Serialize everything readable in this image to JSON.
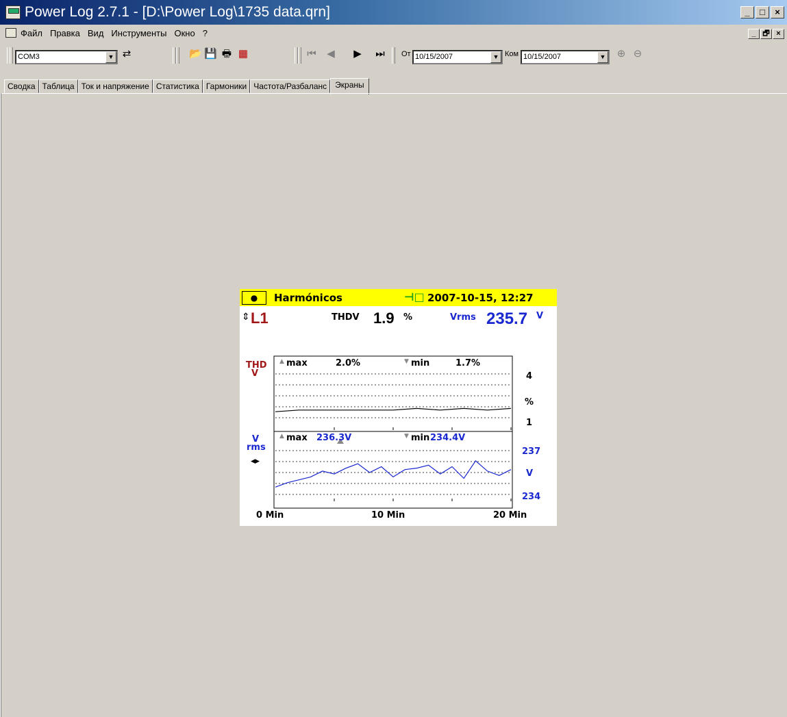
{
  "window": {
    "title": "Power Log 2.7.1 - [D:\\Power Log\\1735 data.qrn]",
    "minimize": "_",
    "maximize": "□",
    "close": "×",
    "mdi_minimize": "_",
    "mdi_restore": "🗗",
    "mdi_close": "×"
  },
  "menu": {
    "items": [
      "Файл",
      "Правка",
      "Вид",
      "Инструменты",
      "Окно",
      "?"
    ]
  },
  "toolbar": {
    "port": "COM3",
    "from_label": "От",
    "from_date": "10/15/2007",
    "to_label": "Ком",
    "to_date": "10/15/2007"
  },
  "tabs": [
    "Сводка",
    "Таблица",
    "Ток и напряжение",
    "Статистика",
    "Гармоники",
    "Частота/Разбаланс",
    "Экраны"
  ],
  "active_tab": "Экраны",
  "screen": {
    "rec_indicator": "●",
    "mode": "Harmónicos",
    "timestamp": "2007-10-15, 12:27",
    "phase": "L1",
    "thdv_label": "THDV",
    "thdv_value": "1.9",
    "thdv_unit": "%",
    "vrms_label": "Vrms",
    "vrms_value": "235.7",
    "vrms_unit": "V",
    "thd_axis_label_top": "THD",
    "thd_axis_label_bottom": "V",
    "thd_max_label": "max",
    "thd_max": "2.0%",
    "thd_min_label": "min",
    "thd_min": "1.7%",
    "thd_scale": [
      "4",
      "%",
      "1"
    ],
    "v_axis_label_top": "V",
    "v_axis_label_bottom": "rms",
    "v_max_label": "max",
    "v_max": "236.3V",
    "v_min_label": "min",
    "v_min": "234.4V",
    "v_scale": [
      "237",
      "V",
      "234"
    ],
    "time_labels": [
      "0 Min",
      "10 Min",
      "20 Min"
    ],
    "colors": {
      "header": "#ffff00",
      "voltage": "#1a28d0",
      "phase": "#a01818",
      "plug": "#18a018"
    }
  },
  "chart_data": [
    {
      "type": "line",
      "title": "THD V",
      "ylabel": "%",
      "ylim": [
        1,
        4
      ],
      "x": [
        0,
        2,
        4,
        6,
        8,
        10,
        12,
        14,
        16,
        18,
        20
      ],
      "series": [
        {
          "name": "THD V",
          "values": [
            1.7,
            1.8,
            1.8,
            1.8,
            1.8,
            1.8,
            1.9,
            1.8,
            1.9,
            1.8,
            1.9
          ]
        }
      ]
    },
    {
      "type": "line",
      "title": "V rms",
      "ylabel": "V",
      "ylim": [
        234,
        237
      ],
      "x": [
        0,
        1,
        2,
        3,
        4,
        5,
        6,
        7,
        8,
        9,
        10,
        11,
        12,
        13,
        14,
        15,
        16,
        17,
        18,
        19,
        20
      ],
      "series": [
        {
          "name": "V rms",
          "values": [
            234.5,
            234.8,
            235.0,
            235.2,
            235.6,
            235.4,
            235.8,
            236.1,
            235.5,
            235.9,
            235.2,
            235.7,
            235.8,
            236.0,
            235.4,
            235.9,
            235.1,
            236.3,
            235.6,
            235.3,
            235.7
          ]
        }
      ]
    }
  ]
}
